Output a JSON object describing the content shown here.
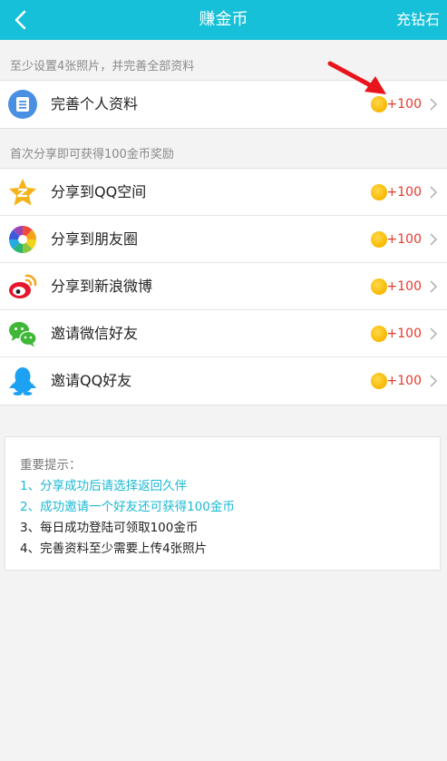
{
  "header": {
    "title": "赚金币",
    "right_label": "充钻石"
  },
  "section1": {
    "label": "至少设置4张照片，并完善全部资料",
    "items": [
      {
        "label": "完善个人资料",
        "reward": "+100",
        "icon": "profile-icon"
      }
    ]
  },
  "section2": {
    "label": "首次分享即可获得100金币奖励",
    "items": [
      {
        "label": "分享到QQ空间",
        "reward": "+100",
        "icon": "qzone-icon"
      },
      {
        "label": "分享到朋友圈",
        "reward": "+100",
        "icon": "moments-icon"
      },
      {
        "label": "分享到新浪微博",
        "reward": "+100",
        "icon": "weibo-icon"
      },
      {
        "label": "邀请微信好友",
        "reward": "+100",
        "icon": "wechat-icon"
      },
      {
        "label": "邀请QQ好友",
        "reward": "+100",
        "icon": "qq-icon"
      }
    ]
  },
  "tips": {
    "title": "重要提示：",
    "lines": [
      "1、分享成功后请选择返回久伴",
      "2、成功邀请一个好友还可获得100金币",
      "3、每日成功登陆可领取100金币",
      "4、完善资料至少需要上传4张照片"
    ]
  },
  "colors": {
    "header_bg": "#15c0d8",
    "reward_text": "#e23a2f",
    "tip_highlight": "#1ab9d3",
    "coin": "#f7b800"
  }
}
